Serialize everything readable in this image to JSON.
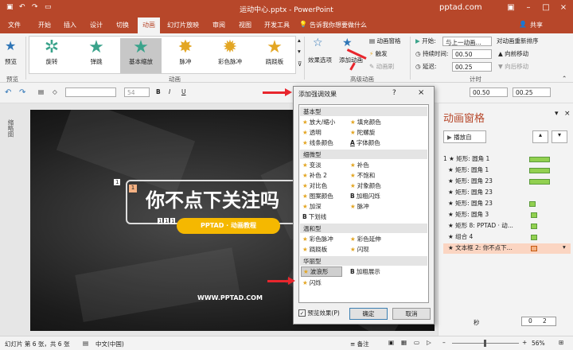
{
  "titlebar": {
    "title": "运动中心.pptx  -  PowerPoint",
    "site": "pptad.com"
  },
  "tabs": [
    "文件",
    "开始",
    "插入",
    "设计",
    "切换",
    "动画",
    "幻灯片放映",
    "审阅",
    "视图",
    "开发工具"
  ],
  "tell_me": "告诉我你想要做什么",
  "share": "共享",
  "ribbon": {
    "preview": "预览",
    "preview_group": "预览",
    "gallery_items": [
      "旋转",
      "弹跳",
      "基本缩放",
      "脉冲",
      "彩色脉冲",
      "跷跷板"
    ],
    "animation_group": "动画",
    "effect_options": "效果选项",
    "add_animation": "添加动画",
    "animation_pane": "动画窗格",
    "trigger": "触发",
    "painter": "动画刷",
    "advanced_group": "高级动画",
    "start_label": "开始:",
    "start_value": "与上一动画...",
    "duration_label": "持续时间:",
    "duration_value": "00.50",
    "delay_label": "延迟:",
    "delay_value": "00.25",
    "timing_group": "计时",
    "reorder_label": "对动画重新排序",
    "move_earlier": "向前移动",
    "move_later": "向后移动"
  },
  "toolbar2": {
    "font_size": "54",
    "spin1": "00.50",
    "spin2": "00.25"
  },
  "slide": {
    "title": "你不点下关注吗",
    "pill": "PPTAD · 动画教程",
    "url": "WWW.PPTAD.COM",
    "tag1": "1",
    "tag2": "1",
    "tags_low": [
      "1",
      "1",
      "1"
    ]
  },
  "dialog": {
    "title": "添加强调效果",
    "help": "?",
    "close": "×",
    "categories": [
      {
        "name": "基本型",
        "items": [
          [
            "放大/缩小",
            "填充颜色"
          ],
          [
            "透明",
            "陀螺旋"
          ],
          [
            "线条颜色",
            "字体颜色"
          ]
        ]
      },
      {
        "name": "细微型",
        "items": [
          [
            "变淡",
            "补色"
          ],
          [
            "补色 2",
            "不饱和"
          ],
          [
            "对比色",
            "对象颜色"
          ],
          [
            "图案颜色",
            "加粗闪烁"
          ],
          [
            "加深",
            "脉冲"
          ],
          [
            "下划线",
            ""
          ]
        ]
      },
      {
        "name": "温和型",
        "items": [
          [
            "彩色脉冲",
            "彩色延伸"
          ],
          [
            "跷跷板",
            "闪现"
          ]
        ]
      },
      {
        "name": "华丽型",
        "items": [
          [
            "波浪形",
            "加粗展示"
          ],
          [
            "闪烁",
            ""
          ]
        ]
      }
    ],
    "preview_effect": "预览效果(P)",
    "ok": "确定",
    "cancel": "取消"
  },
  "pane": {
    "title": "动画窗格",
    "play": "播放自",
    "items": [
      "1 ★ 矩形: 圆角 1",
      "★ 矩形: 圆角 1",
      "★ 矩形: 圆角 23",
      "★ 矩形: 圆角 23",
      "★ 矩形: 圆角 23",
      "★ 矩形: 圆角 3",
      "★ 矩形 8: PPTAD · 动...",
      "★ 组合 4",
      "★ 文本框 2: 你不点下..."
    ],
    "seconds_label": "秒",
    "scale_values": [
      "0",
      "2"
    ]
  },
  "status": {
    "slide": "幻灯片 第 6 张，共 6 张",
    "lang": "中文(中国)",
    "notes": "备注",
    "zoom": "56%"
  },
  "colors": {
    "accent": "#b7472a",
    "star": "#e3a623",
    "bar": "#92d050",
    "pill": "#f5b800",
    "arrow": "#e8262d"
  }
}
